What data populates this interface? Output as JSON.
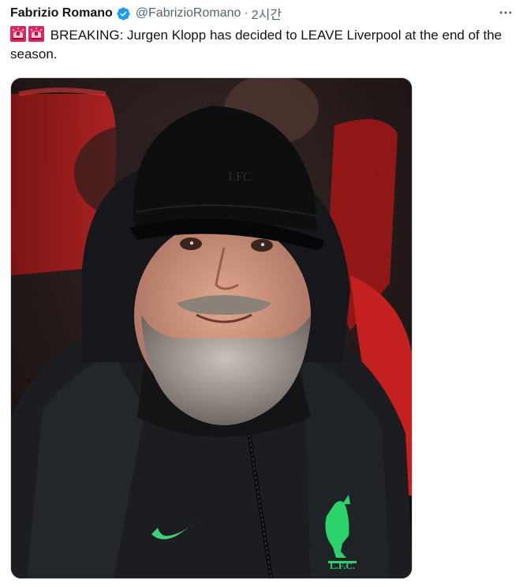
{
  "author": {
    "display_name": "Fabrizio Romano",
    "verified": true,
    "verified_icon": "verified-badge-icon",
    "handle": "@FabrizioRomano",
    "separator": "·",
    "time": "2시간"
  },
  "tweet": {
    "emoji_icons": [
      "police-light-icon",
      "police-light-icon"
    ],
    "text": "BREAKING: Jurgen Klopp has decided to LEAVE Liverpool at the end of the season."
  },
  "media": {
    "photo_icon": "photo-of-man-in-cap-and-jacket",
    "cap_text": "LFC",
    "crest_text": "L.F.C."
  },
  "more_icon": "more-horizontal-icon",
  "colors": {
    "verified": "#1d9bf0",
    "secondary_text": "#536471",
    "nike_swoosh": "#3fd07a",
    "crest": "#2bd46b"
  }
}
